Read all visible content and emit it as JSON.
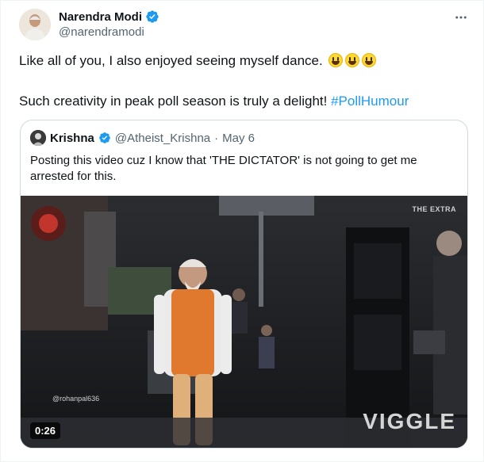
{
  "tweet": {
    "author_name": "Narendra Modi",
    "author_handle": "@narendramodi",
    "line1": "Like all of you, I also enjoyed seeing myself dance.",
    "line2_text": "Such creativity in peak poll season is truly a delight! ",
    "hashtag": "#PollHumour",
    "more_icon": "more-dots-icon",
    "verified_icon": "verified-badge-icon",
    "emoji_icon": "grinning-face-icon",
    "emoji_count": 3
  },
  "quoted": {
    "author_name": "Krishna",
    "author_handle": "@Atheist_Krishna",
    "separator": "·",
    "date": "May 6",
    "text": "Posting this video cuz I know that 'THE DICTATOR' is not going to get me arrested for this.",
    "video": {
      "duration": "0:26",
      "watermark": "VIGGLE",
      "corner_logo": "THE EXTRA",
      "credit": "@rohanpal636"
    }
  },
  "colors": {
    "link": "#1d9bf0",
    "secondary_text": "#536471",
    "verified": "#1d9bf0",
    "border": "#cfd9de"
  }
}
